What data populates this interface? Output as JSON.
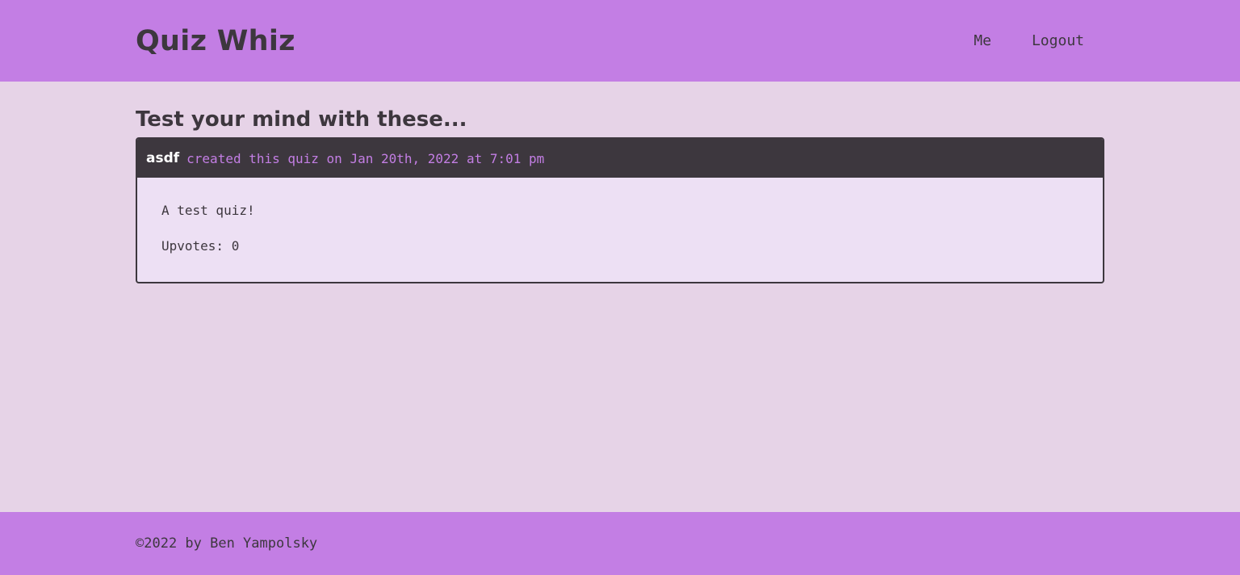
{
  "header": {
    "brand": "Quiz Whiz",
    "nav": [
      {
        "label": "Me"
      },
      {
        "label": "Logout"
      }
    ]
  },
  "main": {
    "section_title": "Test your mind with these...",
    "quizzes": [
      {
        "author": "asdf",
        "meta": "created this quiz on Jan 20th, 2022 at 7:01 pm",
        "description": "A test quiz!",
        "upvotes": "Upvotes: 0"
      }
    ]
  },
  "footer": {
    "text": "©2022 by Ben Yampolsky"
  },
  "colors": {
    "header_bg": "#c37ee4",
    "page_bg": "#e6d3e7",
    "card_header_bg": "#3d373e",
    "card_body_bg": "#ede0f4",
    "text": "#3d373e"
  }
}
